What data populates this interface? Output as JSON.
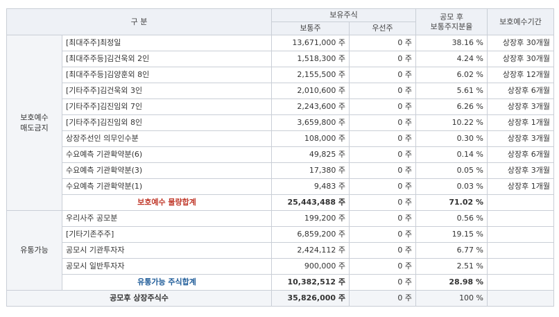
{
  "header": {
    "category": "구 분",
    "holdings": "보유주식",
    "common": "보통주",
    "preferred": "우선주",
    "ratio_l1": "공모 후",
    "ratio_l2": "보통주지분율",
    "lockup": "보호예수기간"
  },
  "group1": {
    "label_l1": "보호예수",
    "label_l2": "매도금지",
    "rows": [
      {
        "name": "[최대주주]최정일",
        "common": "13,671,000 주",
        "preferred": "0 주",
        "ratio": "38.16 %",
        "period": "상장후 30개월"
      },
      {
        "name": "[최대주주등]김건욱외 2인",
        "common": "1,518,300 주",
        "preferred": "0 주",
        "ratio": "4.24 %",
        "period": "상장후 30개월"
      },
      {
        "name": "[최대주주등]김양훈외 8인",
        "common": "2,155,500 주",
        "preferred": "0 주",
        "ratio": "6.02 %",
        "period": "상장후 12개월"
      },
      {
        "name": "[기타주주]김건욱외 3인",
        "common": "2,010,600 주",
        "preferred": "0 주",
        "ratio": "5.61 %",
        "period": "상장후 6개월"
      },
      {
        "name": "[기타주주]김진임외 7인",
        "common": "2,243,600 주",
        "preferred": "0 주",
        "ratio": "6.26 %",
        "period": "상장후 3개월"
      },
      {
        "name": "[기타주주]김진임외 8인",
        "common": "3,659,800 주",
        "preferred": "0 주",
        "ratio": "10.22 %",
        "period": "상장후 1개월"
      },
      {
        "name": "상장주선인 의무인수분",
        "common": "108,000 주",
        "preferred": "0 주",
        "ratio": "0.30 %",
        "period": "상장후 3개월"
      },
      {
        "name": "수요예측 기관확약분(6)",
        "common": "49,825 주",
        "preferred": "0 주",
        "ratio": "0.14 %",
        "period": "상장후 6개월"
      },
      {
        "name": "수요예측 기관확약분(3)",
        "common": "17,380 주",
        "preferred": "0 주",
        "ratio": "0.05 %",
        "period": "상장후 3개월"
      },
      {
        "name": "수요예측 기관확약분(1)",
        "common": "9,483 주",
        "preferred": "0 주",
        "ratio": "0.03 %",
        "period": "상장후 1개월"
      }
    ],
    "subtotal": {
      "name": "보호예수 물량합계",
      "common": "25,443,488 주",
      "preferred": "0 주",
      "ratio": "71.02 %"
    }
  },
  "group2": {
    "label": "유통가능",
    "rows": [
      {
        "name": "우리사주 공모분",
        "common": "199,200 주",
        "preferred": "0 주",
        "ratio": "0.56 %"
      },
      {
        "name": "[기타기존주주]",
        "common": "6,859,200 주",
        "preferred": "0 주",
        "ratio": "19.15 %"
      },
      {
        "name": "공모시 기관투자자",
        "common": "2,424,112 주",
        "preferred": "0 주",
        "ratio": "6.77 %"
      },
      {
        "name": "공모시 일반투자자",
        "common": "900,000 주",
        "preferred": "0 주",
        "ratio": "2.51 %"
      }
    ],
    "subtotal": {
      "name": "유통가능 주식합계",
      "common": "10,382,512 주",
      "preferred": "0 주",
      "ratio": "28.98 %"
    }
  },
  "total": {
    "name": "공모후 상장주식수",
    "common": "35,826,000 주",
    "preferred": "0 주",
    "ratio": "100 %"
  }
}
